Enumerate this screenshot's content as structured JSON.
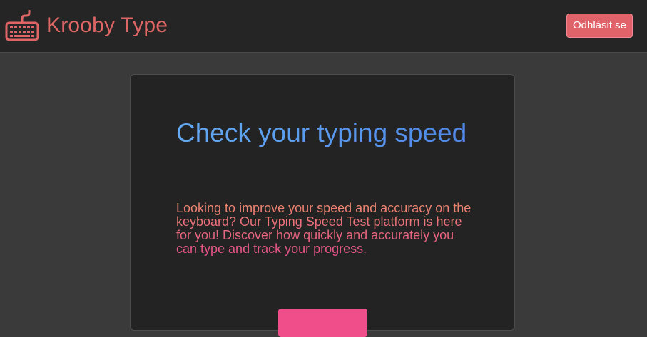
{
  "navbar": {
    "brand_name": "Krooby Type",
    "brand_icon": "keyboard-icon",
    "logout_label": "Odhlásit se"
  },
  "hero": {
    "title": "Check your typing speed",
    "description": "Looking to improve your speed and accuracy on the keyboard? Our Typing Speed Test platform is here for you! Discover how quickly and accurately you can type and track your progress.",
    "start_button_label": ""
  },
  "colors": {
    "page_background": "#3a3a3a",
    "navbar_background": "#252525",
    "brand": "#e06666",
    "logout_button": "#e0636a",
    "card_background": "#232323",
    "title_gradient_start": "#64aaf2",
    "title_gradient_end": "#4f88e6",
    "text_gradient_start": "#ee8a6e",
    "text_gradient_end": "#e64f8a",
    "start_button": "#ef4e8b"
  }
}
